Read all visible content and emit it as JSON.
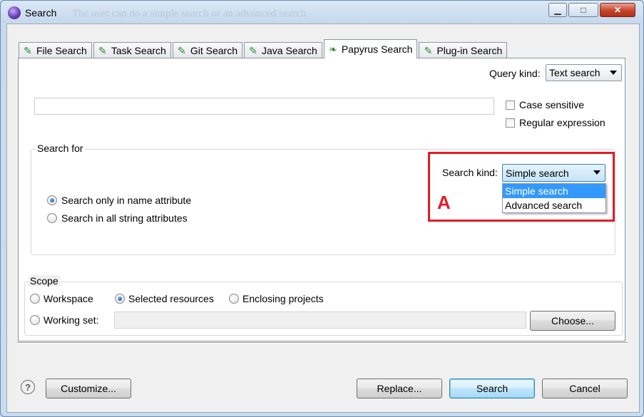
{
  "window": {
    "title": "Search",
    "bg_doc_text": "The user can do a simple search or an advanced search"
  },
  "tabs": [
    {
      "label": "File Search"
    },
    {
      "label": "Task Search"
    },
    {
      "label": "Git Search"
    },
    {
      "label": "Java Search"
    },
    {
      "label": "Papyrus Search",
      "active": true
    },
    {
      "label": "Plug-in Search"
    }
  ],
  "query": {
    "kind_label": "Query kind:",
    "kind_value": "Text search",
    "search_text": "",
    "case_sensitive_label": "Case sensitive",
    "case_sensitive": false,
    "regex_label": "Regular expression",
    "regex": false
  },
  "search_for": {
    "group_label": "Search for",
    "kind_label": "Search kind:",
    "kind_value": "Simple search",
    "options": [
      "Simple search",
      "Advanced search"
    ],
    "radio_name": "Search only in name attribute",
    "radio_all": "Search in all string attributes",
    "selected": "name"
  },
  "annotation": {
    "marker": "A",
    "color": "#e31d23"
  },
  "scope": {
    "group_label": "Scope",
    "workspace": "Workspace",
    "selected_resources": "Selected resources",
    "enclosing_projects": "Enclosing projects",
    "working_set": "Working set:",
    "choose": "Choose...",
    "selected": "selected_resources"
  },
  "buttons": {
    "help": "?",
    "customize": "Customize...",
    "replace": "Replace...",
    "search": "Search",
    "cancel": "Cancel"
  }
}
